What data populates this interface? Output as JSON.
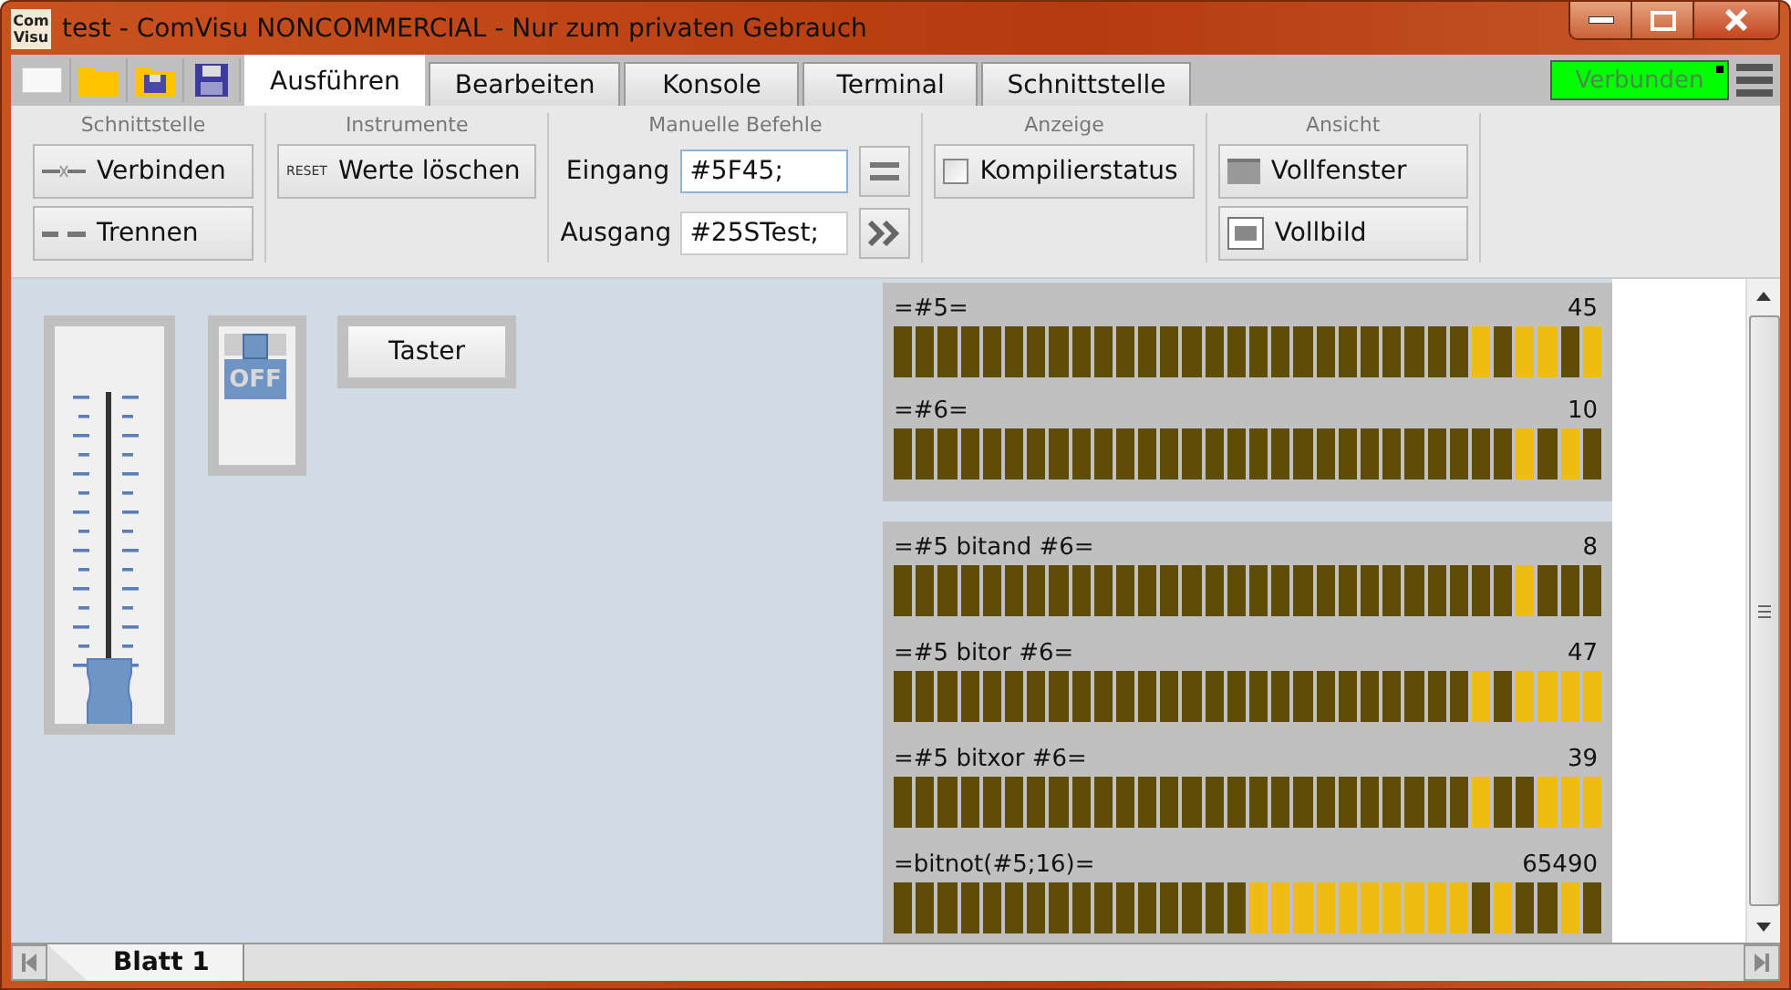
{
  "window": {
    "logo": "Com Visu",
    "title": "test - ComVisu NONCOMMERCIAL - Nur zum privaten Gebrauch"
  },
  "tabs": [
    {
      "label": "Ausführen",
      "selected": true
    },
    {
      "label": "Bearbeiten",
      "selected": false
    },
    {
      "label": "Konsole",
      "selected": false
    },
    {
      "label": "Terminal",
      "selected": false
    },
    {
      "label": "Schnittstelle",
      "selected": false
    }
  ],
  "connection_status": "Verbunden",
  "ribbon": {
    "groups": [
      {
        "title": "Schnittstelle",
        "kind": "buttons",
        "buttons": [
          {
            "label": "Verbinden"
          },
          {
            "label": "Trennen"
          }
        ]
      },
      {
        "title": "Instrumente",
        "kind": "buttons",
        "buttons": [
          {
            "label": "Werte löschen",
            "icon_text": "RESET"
          }
        ]
      },
      {
        "title": "Manuelle Befehle",
        "kind": "commands",
        "fields": [
          {
            "label": "Eingang",
            "value": "#5F45;"
          },
          {
            "label": "Ausgang",
            "value": "#25STest;"
          }
        ]
      },
      {
        "title": "Anzeige",
        "kind": "checkbox",
        "label": "Kompilierstatus",
        "checked": false
      },
      {
        "title": "Ansicht",
        "kind": "buttons",
        "buttons": [
          {
            "label": "Vollfenster"
          },
          {
            "label": "Vollbild"
          }
        ]
      }
    ]
  },
  "canvas": {
    "slider": {
      "level": 0.05
    },
    "switch": {
      "label": "OFF",
      "on": false
    },
    "push_button": {
      "label": "Taster"
    },
    "bit_panels": [
      {
        "rows": [
          {
            "label": "=#5=",
            "reading": "45",
            "bits": [
              false,
              false,
              false,
              false,
              false,
              false,
              false,
              false,
              false,
              false,
              false,
              false,
              false,
              false,
              false,
              false,
              false,
              false,
              false,
              false,
              false,
              false,
              false,
              false,
              false,
              false,
              true,
              false,
              true,
              true,
              false,
              true
            ]
          },
          {
            "label": "=#6=",
            "reading": "10",
            "bits": [
              false,
              false,
              false,
              false,
              false,
              false,
              false,
              false,
              false,
              false,
              false,
              false,
              false,
              false,
              false,
              false,
              false,
              false,
              false,
              false,
              false,
              false,
              false,
              false,
              false,
              false,
              false,
              false,
              true,
              false,
              true,
              false
            ]
          }
        ]
      },
      {
        "rows": [
          {
            "label": "=#5 bitand #6=",
            "reading": "8",
            "bits": [
              false,
              false,
              false,
              false,
              false,
              false,
              false,
              false,
              false,
              false,
              false,
              false,
              false,
              false,
              false,
              false,
              false,
              false,
              false,
              false,
              false,
              false,
              false,
              false,
              false,
              false,
              false,
              false,
              true,
              false,
              false,
              false
            ]
          },
          {
            "label": "=#5 bitor #6=",
            "reading": "47",
            "bits": [
              false,
              false,
              false,
              false,
              false,
              false,
              false,
              false,
              false,
              false,
              false,
              false,
              false,
              false,
              false,
              false,
              false,
              false,
              false,
              false,
              false,
              false,
              false,
              false,
              false,
              false,
              true,
              false,
              true,
              true,
              true,
              true
            ]
          },
          {
            "label": "=#5 bitxor #6=",
            "reading": "39",
            "bits": [
              false,
              false,
              false,
              false,
              false,
              false,
              false,
              false,
              false,
              false,
              false,
              false,
              false,
              false,
              false,
              false,
              false,
              false,
              false,
              false,
              false,
              false,
              false,
              false,
              false,
              false,
              true,
              false,
              false,
              true,
              true,
              true
            ]
          },
          {
            "label": "=bitnot(#5;16)=",
            "reading": "65490",
            "bits": [
              false,
              false,
              false,
              false,
              false,
              false,
              false,
              false,
              false,
              false,
              false,
              false,
              false,
              false,
              false,
              false,
              true,
              true,
              true,
              true,
              true,
              true,
              true,
              true,
              true,
              true,
              false,
              true,
              false,
              false,
              true,
              false
            ]
          }
        ]
      }
    ]
  },
  "sheet_tabs": [
    {
      "label": "Blatt 1",
      "selected": true
    }
  ]
}
